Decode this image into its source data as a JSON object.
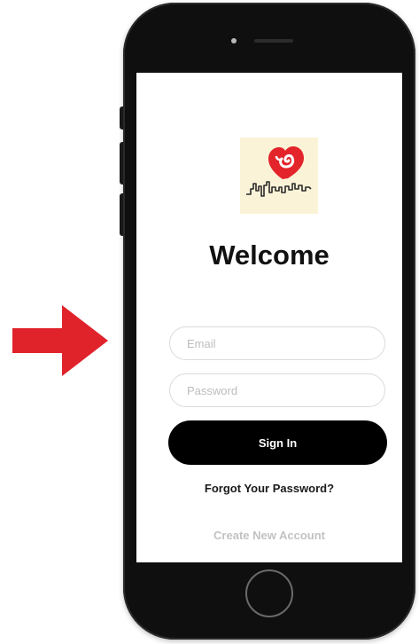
{
  "pointer": {
    "icon": "right-arrow-icon",
    "color": "#e0232b"
  },
  "logo": {
    "icon": "heart-skyline-logo",
    "heart_color": "#e3242b",
    "background": "#fbf3d7"
  },
  "login": {
    "title": "Welcome",
    "email_placeholder": "Email",
    "password_placeholder": "Password",
    "signin_label": "Sign In",
    "forgot_label": "Forgot Your Password?",
    "create_label": "Create New Account"
  }
}
